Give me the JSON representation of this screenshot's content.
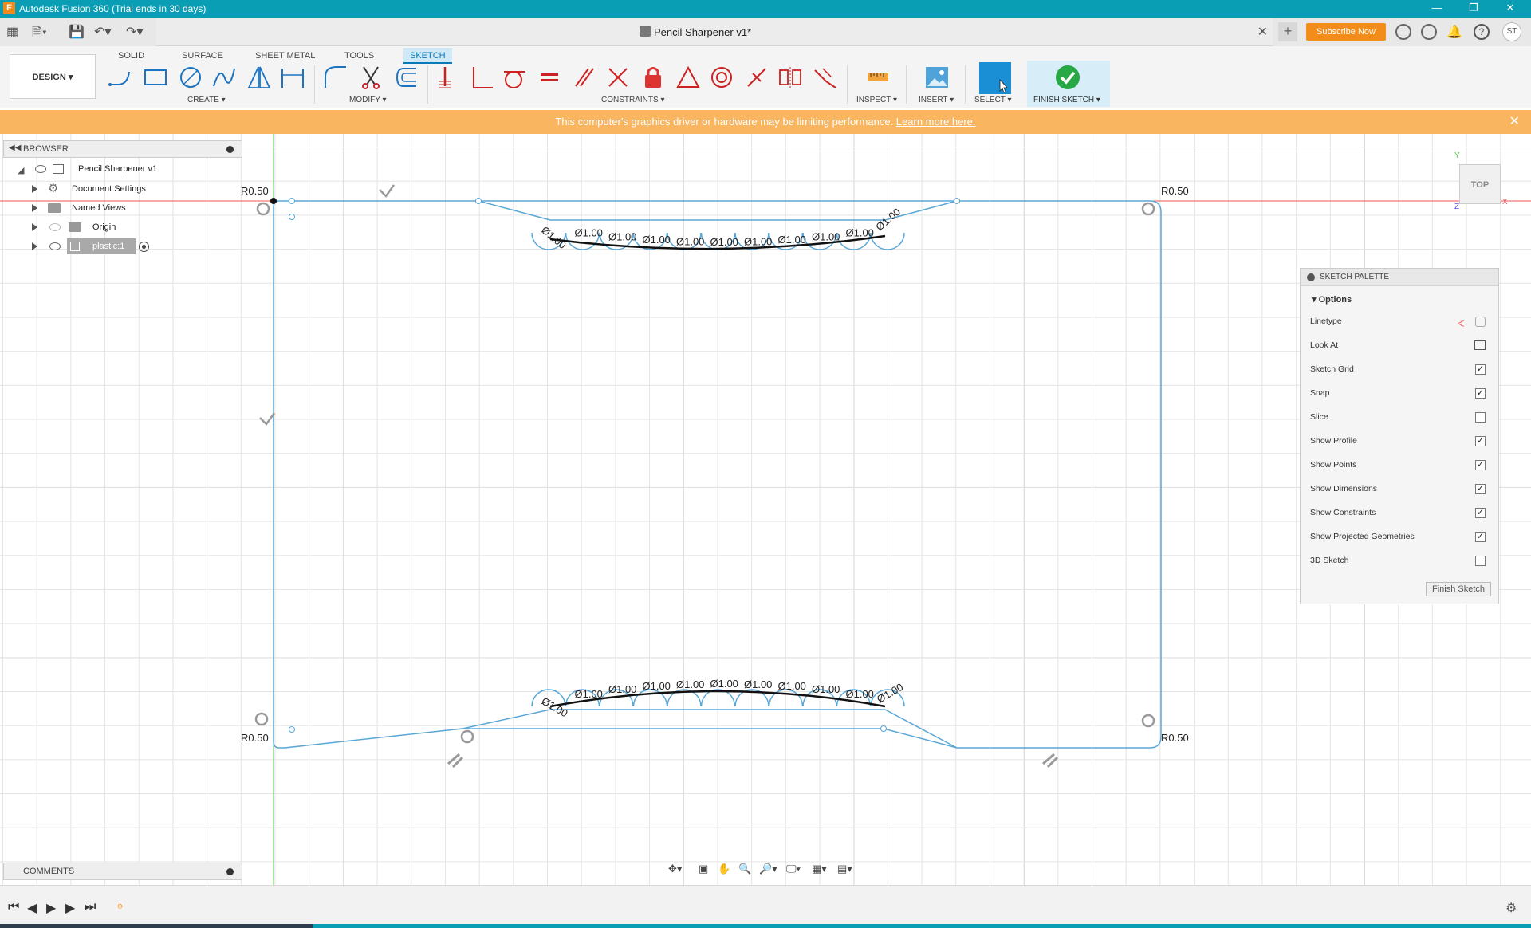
{
  "window": {
    "title": "Autodesk Fusion 360 (Trial ends in 30 days)",
    "app_icon_letter": "F",
    "minimize": "—",
    "restore": "❐",
    "close": "✕"
  },
  "appbar": {
    "document_title": "Pencil Sharpener v1*",
    "subscribe_label": "Subscribe Now",
    "avatar_initials": "ST",
    "new_tab": "+",
    "close_tab": "✕"
  },
  "toolbar": {
    "workspace_label": "DESIGN ▾",
    "tabs": [
      "SOLID",
      "SURFACE",
      "SHEET METAL",
      "TOOLS",
      "SKETCH"
    ],
    "active_tab": "SKETCH",
    "groups": {
      "create": "CREATE ▾",
      "modify": "MODIFY ▾",
      "constraints": "CONSTRAINTS ▾",
      "inspect": "INSPECT ▾",
      "insert": "INSERT ▾",
      "select": "SELECT ▾",
      "finish": "FINISH SKETCH ▾"
    }
  },
  "banner": {
    "message": "This computer's graphics driver or hardware may be limiting performance.",
    "link": "Learn more here.",
    "close": "✕"
  },
  "browser": {
    "header": "BROWSER",
    "items": [
      {
        "label": "Pencil Sharpener v1"
      },
      {
        "label": "Document Settings"
      },
      {
        "label": "Named Views"
      },
      {
        "label": "Origin"
      },
      {
        "label": "plastic:1"
      }
    ]
  },
  "sketch": {
    "radius_labels": [
      "R0.50",
      "R0.50",
      "R0.50",
      "R0.50"
    ],
    "diameter_label": "Ø1.00"
  },
  "viewcube": {
    "label": "TOP",
    "axis_y": "Y",
    "axis_x": "X",
    "axis_z": "Z"
  },
  "palette": {
    "title": "SKETCH PALETTE",
    "section": "Options",
    "rows": [
      {
        "label": "Linetype",
        "kind": "icon"
      },
      {
        "label": "Look At",
        "kind": "icon"
      },
      {
        "label": "Sketch Grid",
        "checked": true
      },
      {
        "label": "Snap",
        "checked": true
      },
      {
        "label": "Slice",
        "checked": false
      },
      {
        "label": "Show Profile",
        "checked": true
      },
      {
        "label": "Show Points",
        "checked": true
      },
      {
        "label": "Show Dimensions",
        "checked": true
      },
      {
        "label": "Show Constraints",
        "checked": true
      },
      {
        "label": "Show Projected Geometries",
        "checked": true
      },
      {
        "label": "3D Sketch",
        "checked": false
      }
    ],
    "finish_button": "Finish Sketch"
  },
  "comments": {
    "header": "COMMENTS"
  },
  "colors": {
    "titlebar": "#0a9eb5",
    "accent_blue": "#0a79b8",
    "banner": "#f9b560",
    "subscribe": "#f28c1b",
    "sketch_line": "#5aa7d6",
    "finish_green": "#27a844"
  }
}
